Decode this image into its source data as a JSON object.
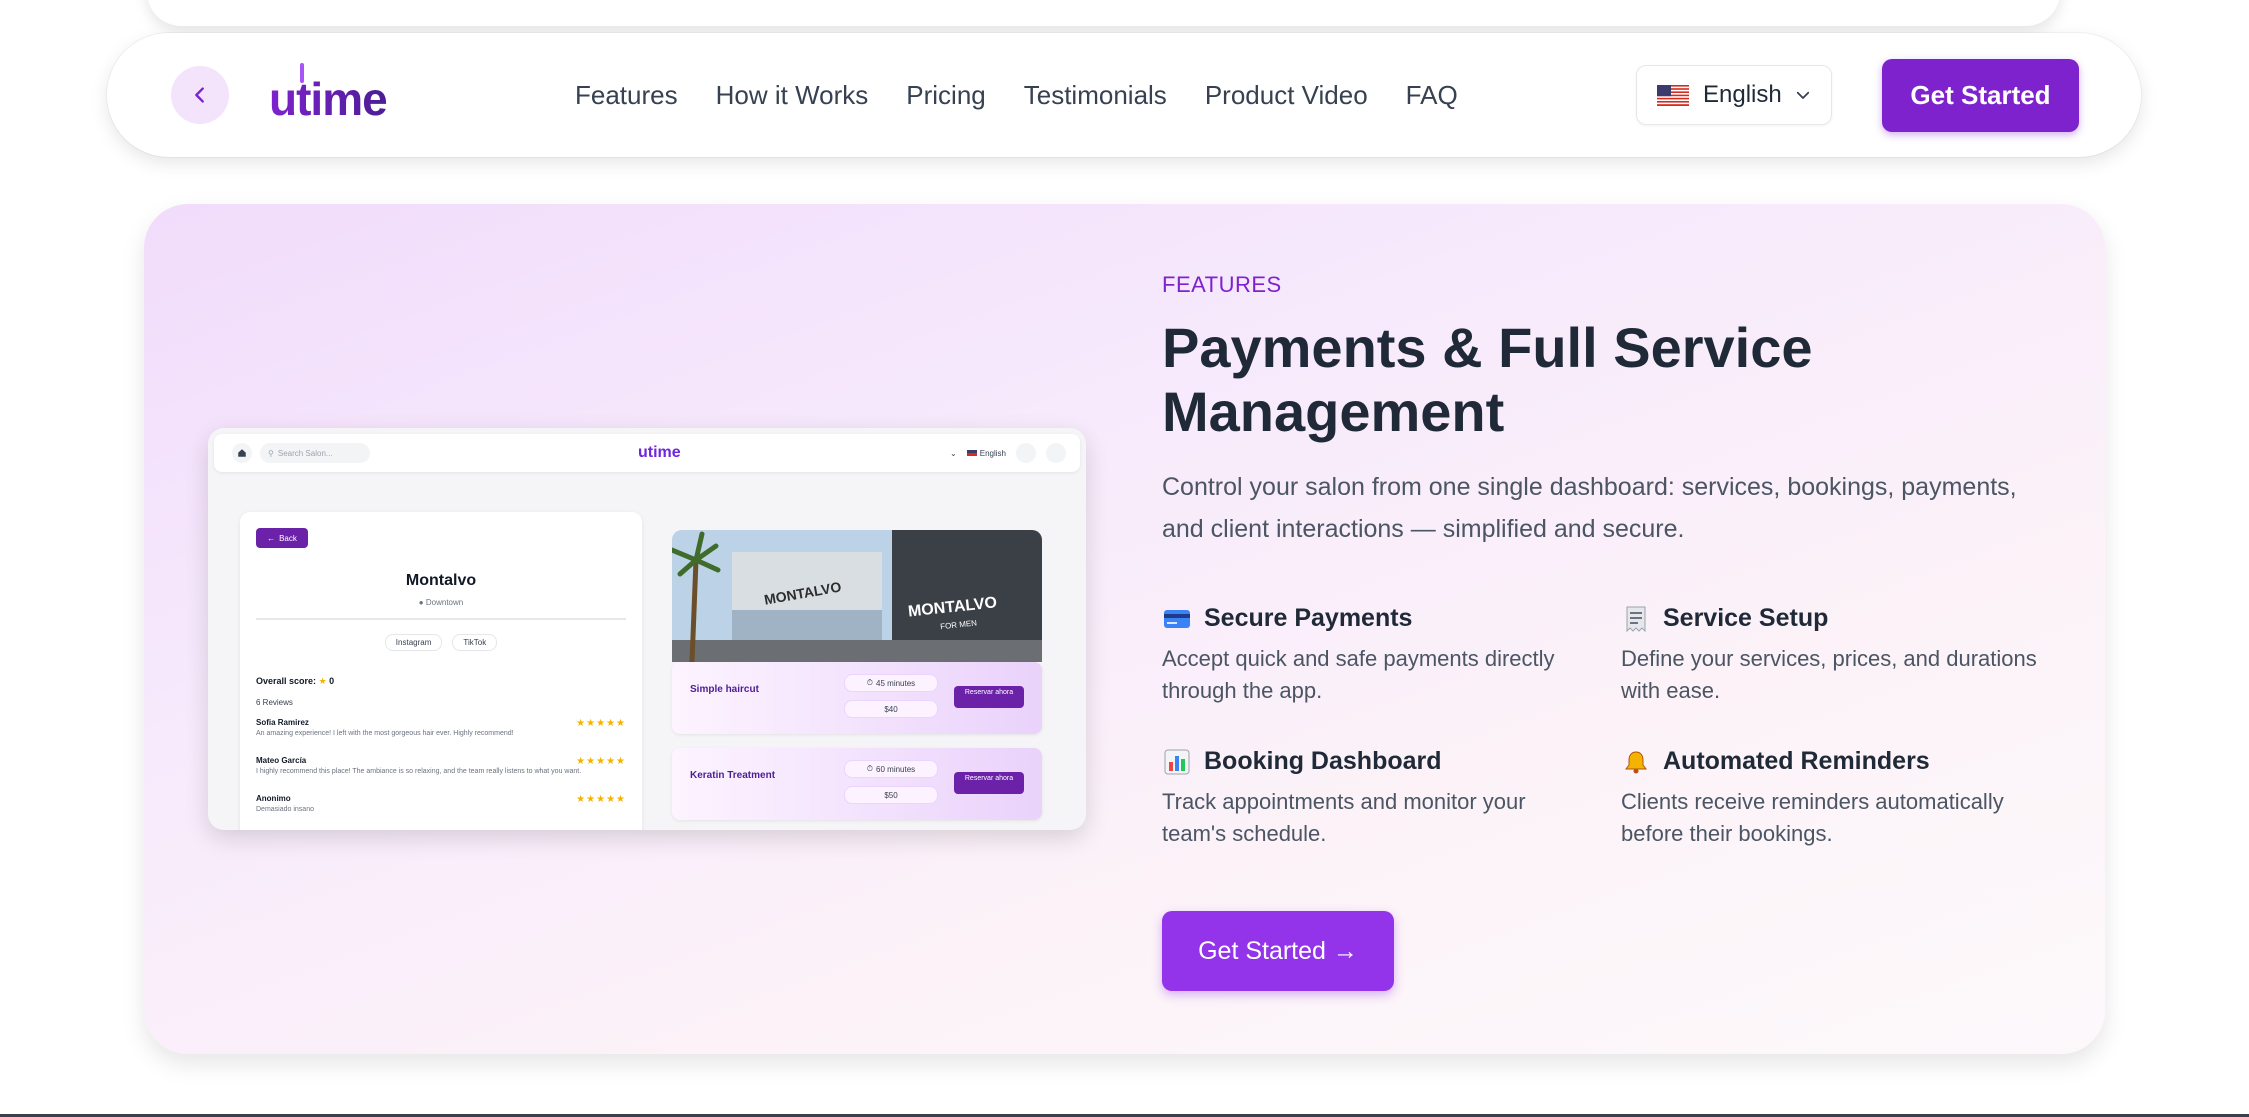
{
  "brand": {
    "logo_text": "utime",
    "accent_color": "#7e22ce"
  },
  "nav": {
    "back_icon": "chevron-left-icon",
    "links": [
      "Features",
      "How it Works",
      "Pricing",
      "Testimonials",
      "Product Video",
      "FAQ"
    ],
    "language": {
      "flag_icon": "us-flag-icon",
      "label": "English"
    },
    "cta": "Get Started"
  },
  "features": {
    "eyebrow": "FEATURES",
    "heading": "Payments & Full Service Management",
    "description": "Control your salon from one single dashboard: services, bookings, payments, and client interactions — simplified and secure.",
    "items": [
      {
        "icon": "credit-card-icon",
        "title": "Secure Payments",
        "text": "Accept quick and safe payments directly through the app."
      },
      {
        "icon": "receipt-icon",
        "title": "Service Setup",
        "text": "Define your services, prices, and durations with ease."
      },
      {
        "icon": "bar-chart-icon",
        "title": "Booking Dashboard",
        "text": "Track appointments and monitor your team's schedule."
      },
      {
        "icon": "bell-icon",
        "title": "Automated Reminders",
        "text": "Clients receive reminders automatically before their bookings."
      }
    ],
    "cta": "Get Started →"
  },
  "preview": {
    "search_placeholder": "Search Salon...",
    "logo": "utime",
    "language": "English",
    "back": "Back",
    "salon_name": "Montalvo",
    "location": "Downtown",
    "tags": [
      "Instagram",
      "TikTok"
    ],
    "score_label": "Overall score:",
    "score": "0",
    "reviews_count": "6 Reviews",
    "reviews": [
      {
        "name": "Sofia Ramirez",
        "text": "An amazing experience! I left with the most gorgeous hair ever. Highly recommend!",
        "rating": 5
      },
      {
        "name": "Mateo García",
        "text": "I highly recommend this place! The ambiance is so relaxing, and the team really listens to what you want.",
        "rating": 5
      },
      {
        "name": "Anonimo",
        "text": "Demasiado insano",
        "rating": 5
      }
    ],
    "photo_sign_1": "MONTALVO",
    "photo_sign_2": "MONTALVO",
    "photo_sign_3": "FOR MEN",
    "services": [
      {
        "name": "Simple haircut",
        "duration": "45 minutes",
        "price": "$40",
        "button": "Reservar ahora"
      },
      {
        "name": "Keratin Treatment",
        "duration": "60 minutes",
        "price": "$50",
        "button": "Reservar ahora"
      }
    ]
  }
}
